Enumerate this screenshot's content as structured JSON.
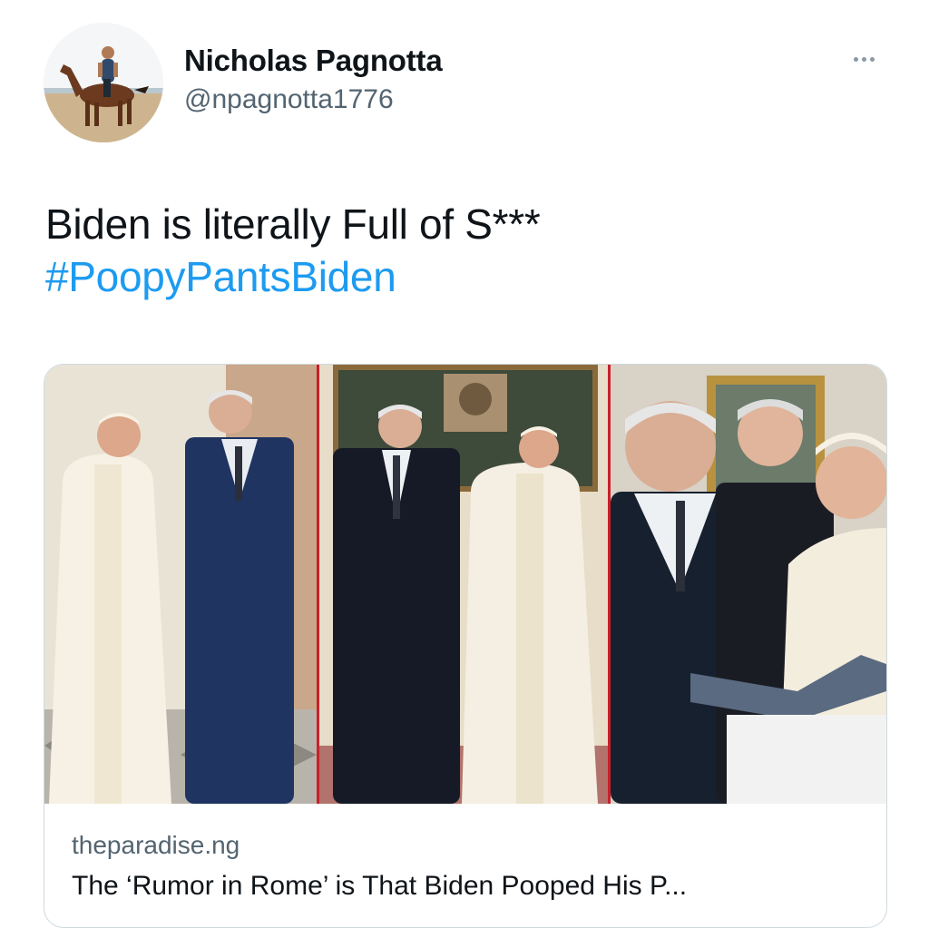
{
  "tweet": {
    "author": {
      "display_name": "Nicholas Pagnotta",
      "handle": "@npagnotta1776",
      "avatar_icon": "profile-photo-horse-rider"
    },
    "more_icon": "more-options-icon",
    "text": "Biden is literally Full of S***",
    "hashtag": "#PoopyPantsBiden",
    "link_card": {
      "image_description_icon": "photo-collage",
      "domain": "theparadise.ng",
      "title": "The ‘Rumor in Rome’ is That Biden Pooped His P..."
    }
  },
  "colors": {
    "text_primary": "#0f1419",
    "text_secondary": "#536471",
    "link": "#1d9bf0",
    "border": "#cfd9de",
    "panel_divider": "#c8202a"
  }
}
